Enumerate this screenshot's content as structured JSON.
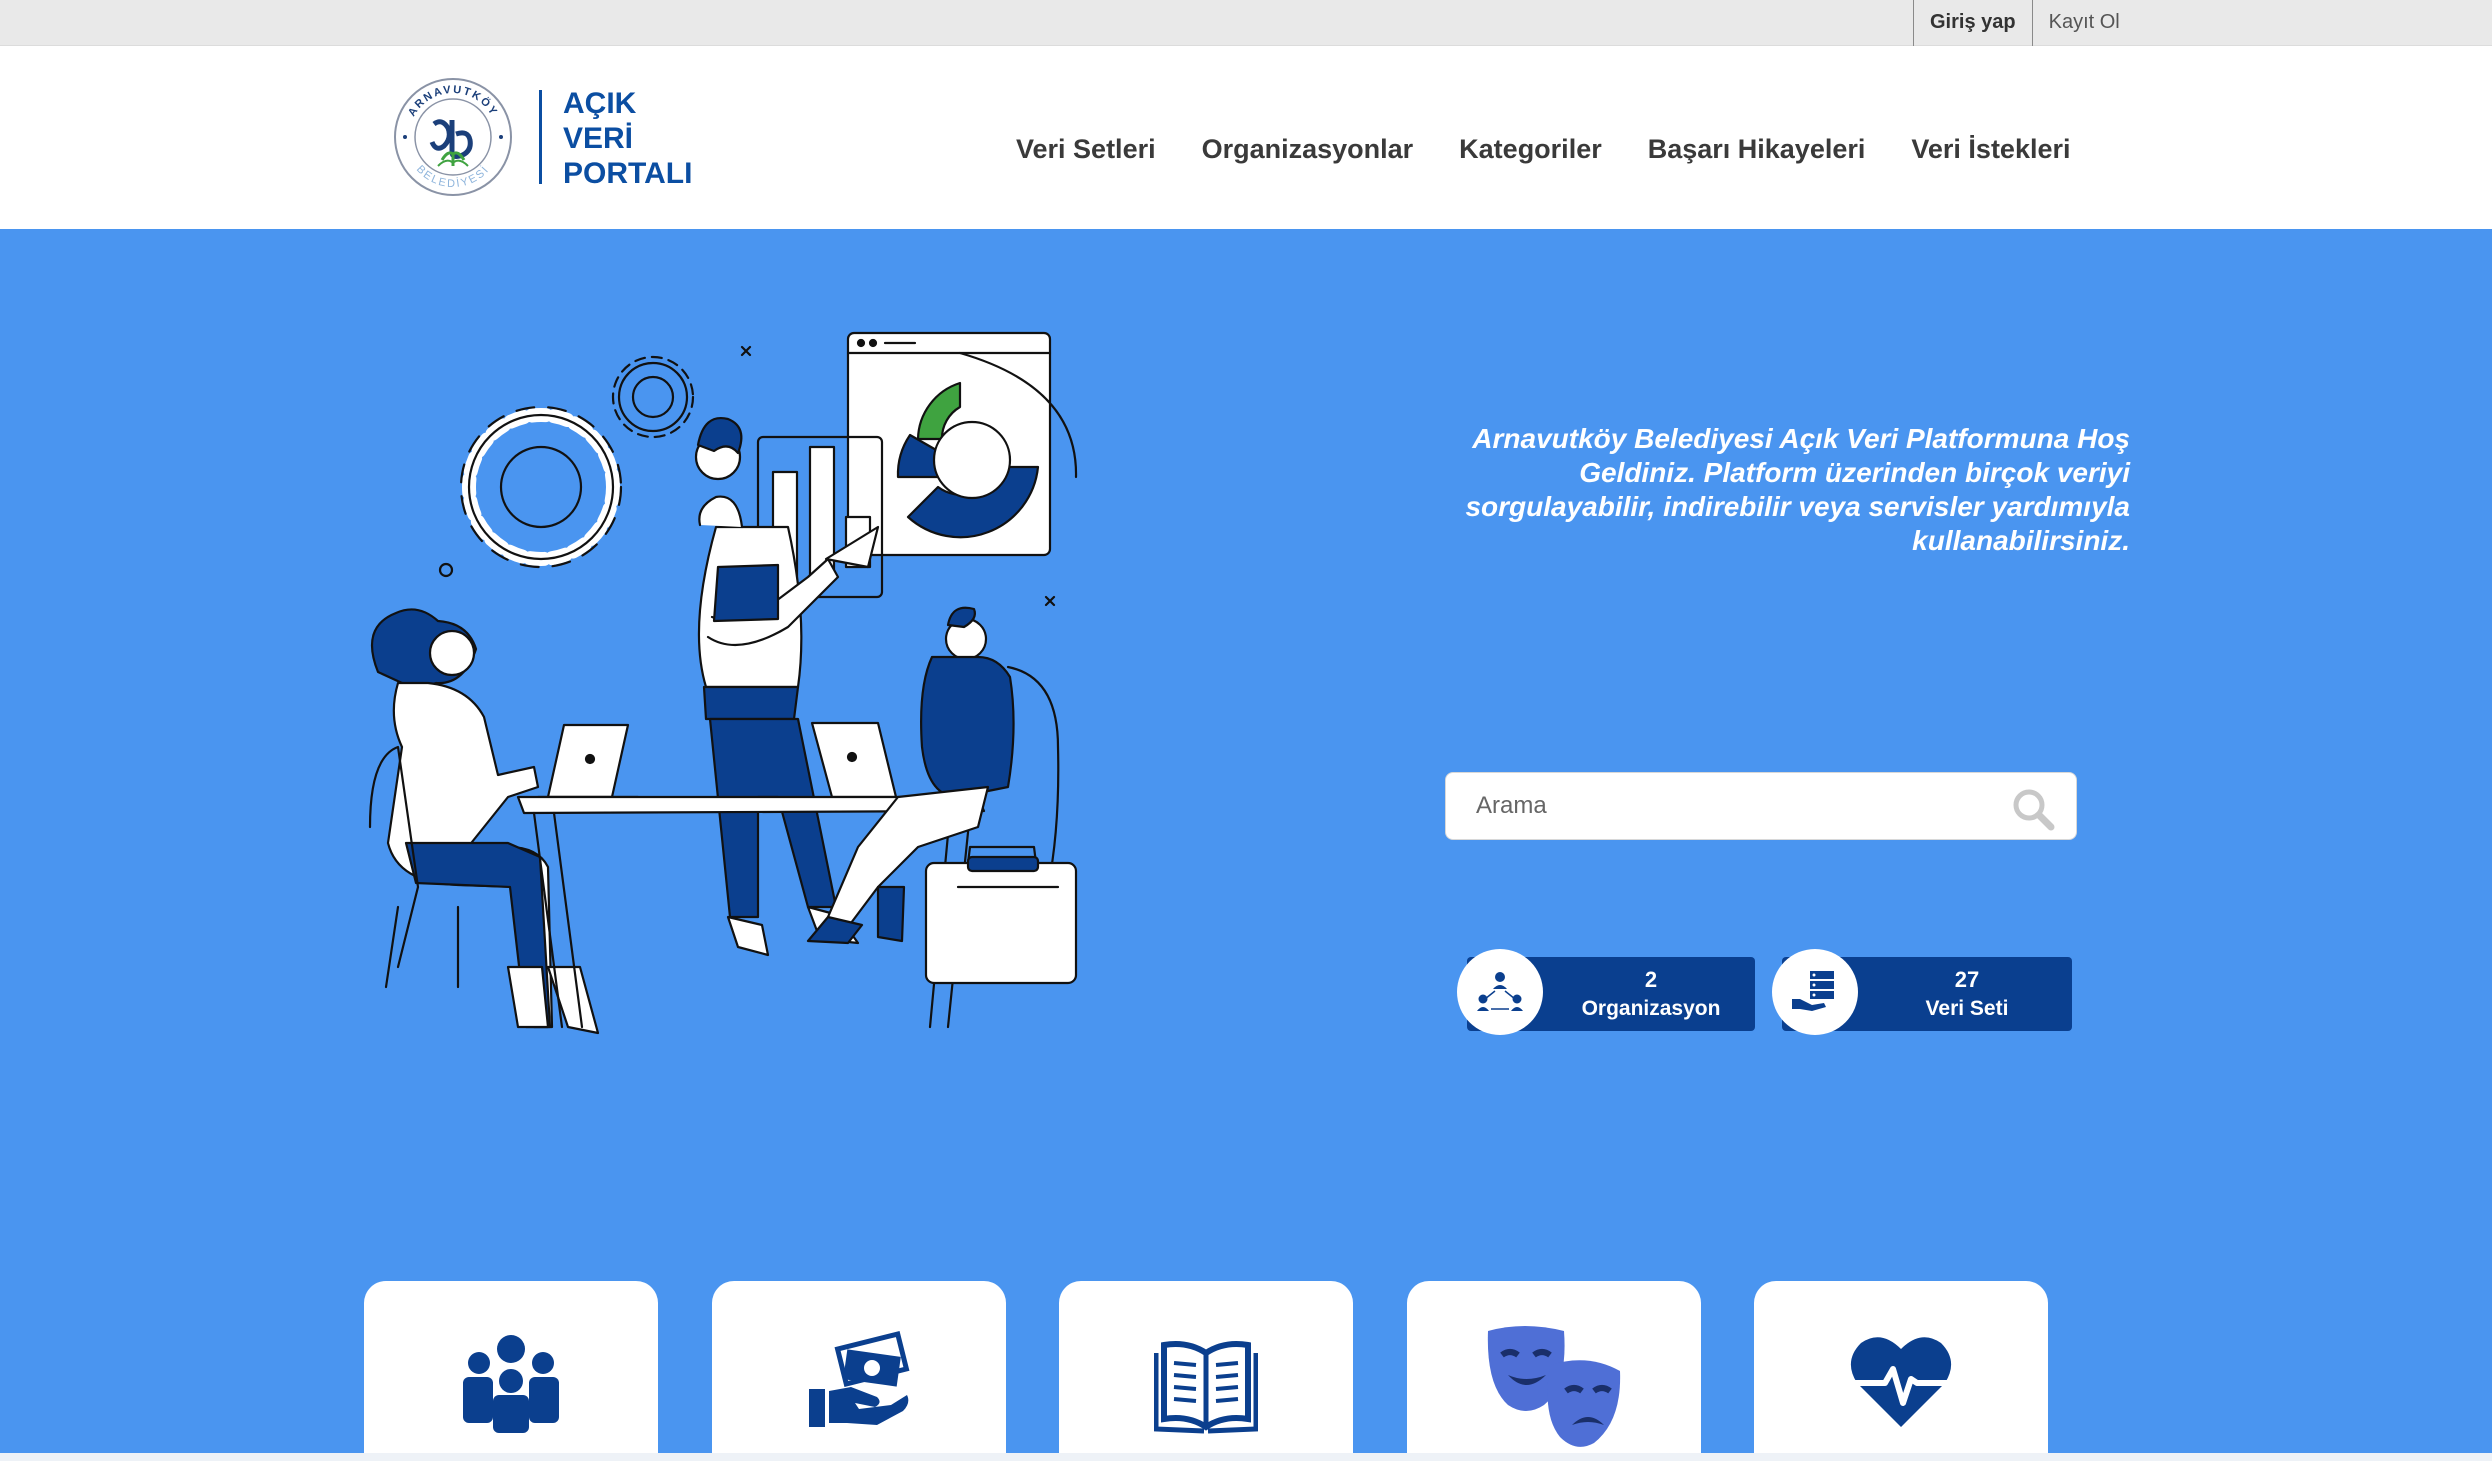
{
  "topbar": {
    "login_label": "Giriş yap",
    "register_label": "Kayıt Ol"
  },
  "header": {
    "logo": {
      "ring_text_top": "ARNAVUTKÖY",
      "ring_text_bottom": "BELEDİYESİ"
    },
    "brand_lines": [
      "AÇIK",
      "VERİ",
      "PORTALI"
    ],
    "nav": [
      "Veri Setleri",
      "Organizasyonlar",
      "Kategoriler",
      "Başarı Hikayeleri",
      "Veri İstekleri"
    ]
  },
  "hero": {
    "welcome": "Arnavutköy Belediyesi Açık Veri Platformuna Hoş Geldiniz. Platform üzerinden birçok veriyi sorgulayabilir, indirebilir veya servisler yardımıyla kullanabilirsiniz.",
    "search": {
      "placeholder": "Arama",
      "value": ""
    },
    "stats": [
      {
        "number": "2",
        "label": "Organizasyon",
        "icon": "organization-network-icon"
      },
      {
        "number": "27",
        "label": "Veri Seti",
        "icon": "dataset-server-hand-icon"
      }
    ],
    "categories": [
      {
        "icon": "people-group-icon"
      },
      {
        "icon": "money-hand-icon"
      },
      {
        "icon": "open-book-icon"
      },
      {
        "icon": "theater-masks-icon"
      },
      {
        "icon": "heart-pulse-icon"
      }
    ]
  },
  "colors": {
    "hero_blue": "#4a95f0",
    "brand_blue": "#0b4ea2",
    "stat_navy": "#0a3f8f",
    "icon_navy": "#0b3f8e",
    "chart_green": "#3fa340"
  }
}
